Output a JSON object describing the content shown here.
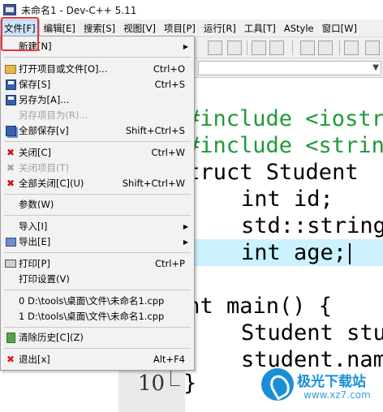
{
  "window": {
    "title": "未命名1 - Dev-C++ 5.11"
  },
  "menubar": {
    "items": [
      {
        "label": "文件[F]",
        "active": true
      },
      {
        "label": "编辑[E]"
      },
      {
        "label": "搜索[S]"
      },
      {
        "label": "视图[V]"
      },
      {
        "label": "项目[P]"
      },
      {
        "label": "运行[R]"
      },
      {
        "label": "工具[T]"
      },
      {
        "label": "AStyle"
      },
      {
        "label": "窗口[W]"
      }
    ]
  },
  "file_menu": {
    "new": {
      "label": "新建[N]"
    },
    "open": {
      "label": "打开项目或文件[O]...",
      "shortcut": "Ctrl+O"
    },
    "save": {
      "label": "保存[S]",
      "shortcut": "Ctrl+S"
    },
    "save_as": {
      "label": "另存为[A]..."
    },
    "save_project_as": {
      "label": "另存项目为(R)..."
    },
    "save_all": {
      "label": "全部保存[v]",
      "shortcut": "Shift+Ctrl+S"
    },
    "close": {
      "label": "关闭[C]",
      "shortcut": "Ctrl+W"
    },
    "close_project": {
      "label": "关闭项目(T)"
    },
    "close_all": {
      "label": "全部关闭[C](U)",
      "shortcut": "Shift+Ctrl+W"
    },
    "properties": {
      "label": "参数(W)"
    },
    "import": {
      "label": "导入[I]"
    },
    "export": {
      "label": "导出[E]"
    },
    "print": {
      "label": "打印[P]",
      "shortcut": "Ctrl+P"
    },
    "print_setup": {
      "label": "打印设置(V)"
    },
    "recent": [
      {
        "label": "0 D:\\tools\\桌面\\文件\\未命名1.cpp"
      },
      {
        "label": "1 D:\\tools\\桌面\\文件\\未命名1.cpp"
      }
    ],
    "clear_history": {
      "label": "清除历史[C](Z)"
    },
    "exit": {
      "label": "退出[x]",
      "shortcut": "Alt+F4"
    }
  },
  "editor": {
    "lines": [
      "#include <iostr",
      "#include <strin",
      "struct Student",
      "    int id;",
      "    std::string",
      "    int age;",
      "",
      "int main() {",
      "    Student stu",
      "    student.nam",
      "}"
    ],
    "visible_line_number": "10"
  },
  "watermark": {
    "title": "极光下载站",
    "url": "www.xz7.com"
  }
}
